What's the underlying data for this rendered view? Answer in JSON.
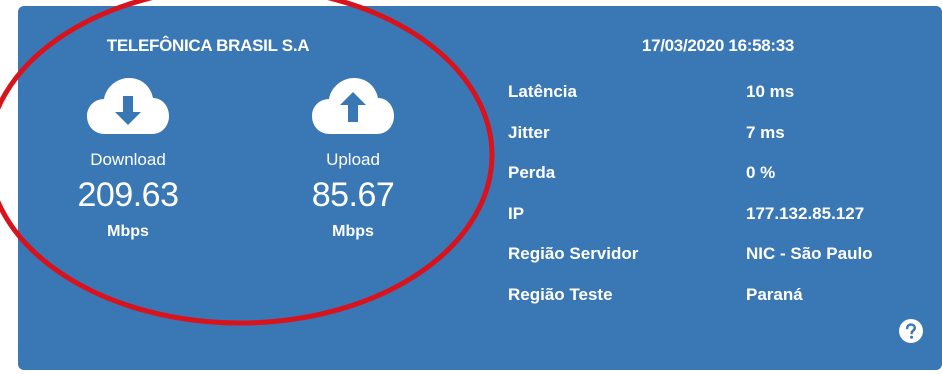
{
  "provider": "TELEFÔNICA BRASIL S.A",
  "timestamp": "17/03/2020 16:58:33",
  "download": {
    "label": "Download",
    "value": "209.63",
    "unit": "Mbps"
  },
  "upload": {
    "label": "Upload",
    "value": "85.67",
    "unit": "Mbps"
  },
  "metrics": [
    {
      "label": "Latência",
      "value": "10 ms"
    },
    {
      "label": "Jitter",
      "value": "7 ms"
    },
    {
      "label": "Perda",
      "value": "0 %"
    },
    {
      "label": "IP",
      "value": "177.132.85.127"
    },
    {
      "label": "Região Servidor",
      "value": "NIC - São Paulo"
    },
    {
      "label": "Região Teste",
      "value": "Paraná"
    }
  ],
  "colors": {
    "card_bg": "#3a77b5",
    "text": "#ffffff",
    "annotation": "#d9121c"
  },
  "icons": {
    "download": "cloud-download-icon",
    "upload": "cloud-upload-icon",
    "help": "help-icon"
  }
}
